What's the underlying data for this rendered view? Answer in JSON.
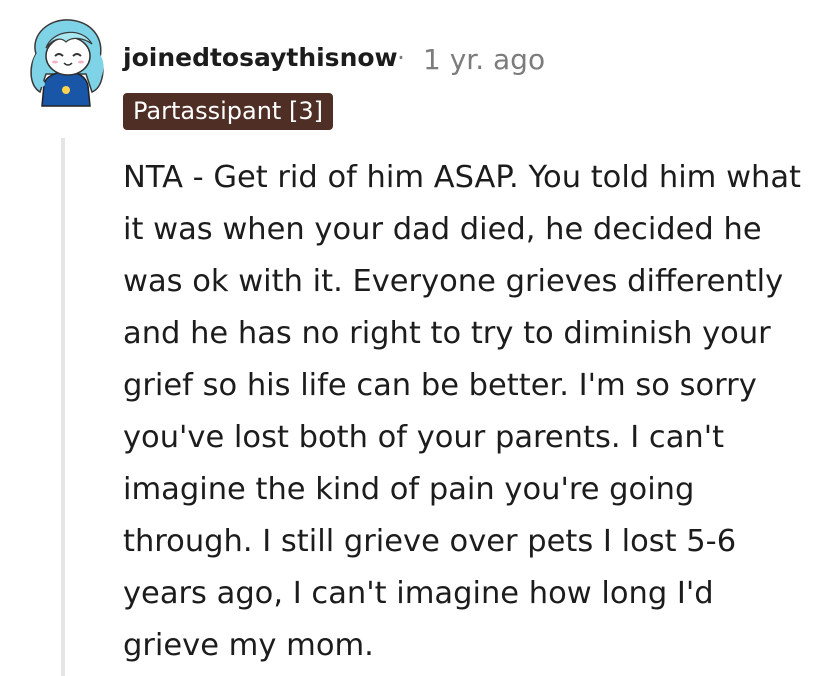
{
  "comment": {
    "username": "joinedtosaythisnow",
    "separator": "·",
    "timestamp": "1 yr. ago",
    "flair": "Partassipant [3]",
    "body": "NTA - Get rid of him ASAP. You told him what it was when your dad died, he decided he was ok with it. Everyone grieves differently and he has no right to try to diminish your grief so his life can be better. I'm so sorry you've lost both of your parents. I can't imagine the kind of pain you're going through. I still grieve over pets I lost 5-6 years ago, I can't imagine how long I'd grieve my mom."
  },
  "colors": {
    "flair_background": "#4f2f25",
    "flair_text": "#ffffff",
    "muted_text": "#7c7c7c",
    "thread_line": "#e5e5e5"
  },
  "icons": {
    "avatar": "snoo-avatar-icon"
  }
}
